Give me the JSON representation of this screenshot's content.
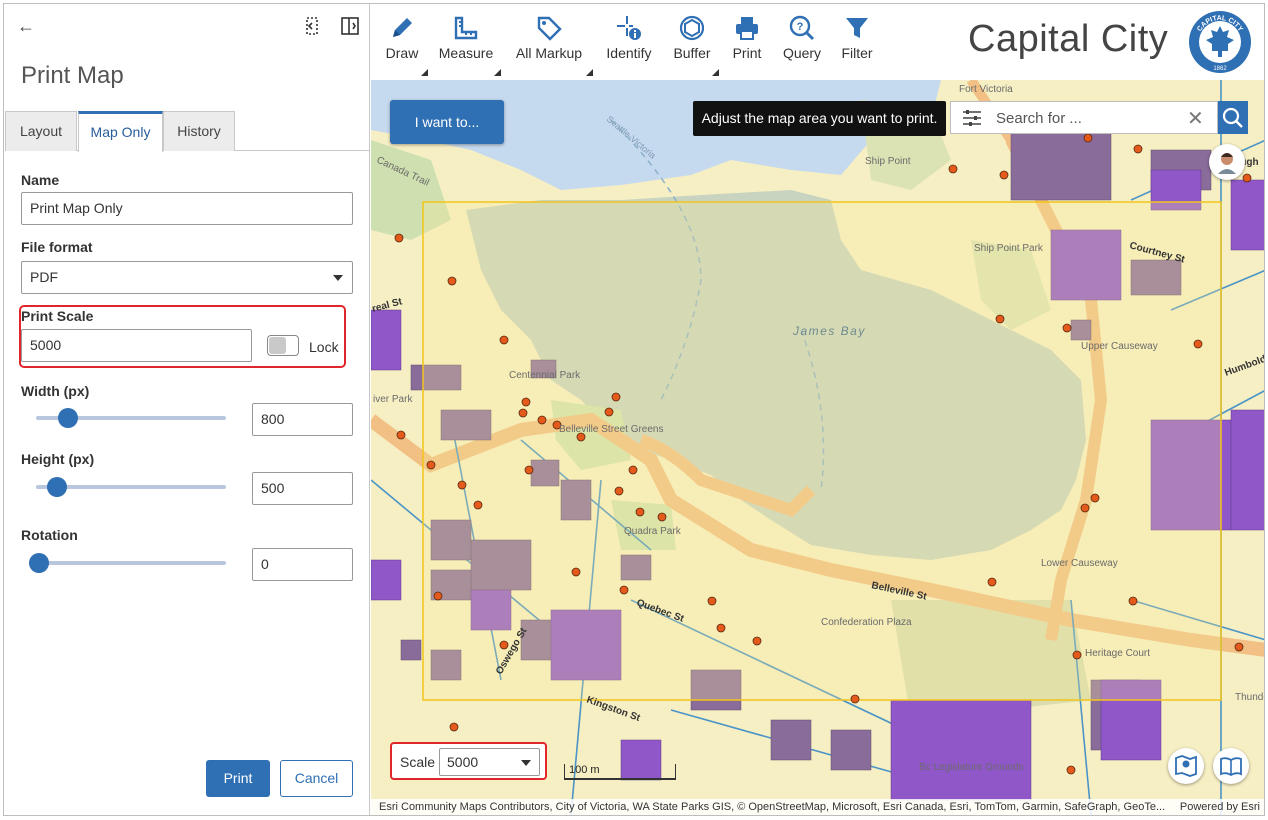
{
  "panel": {
    "title": "Print Map",
    "tabs": [
      {
        "label": "Layout"
      },
      {
        "label": "Map Only"
      },
      {
        "label": "History"
      }
    ],
    "name_label": "Name",
    "name_value": "Print Map Only",
    "file_format_label": "File format",
    "file_format_value": "PDF",
    "print_scale_label": "Print Scale",
    "print_scale_value": "5000",
    "lock_label": "Lock",
    "lock_on": false,
    "width_label": "Width (px)",
    "width_value": "800",
    "width_slider_fraction": 0.16,
    "height_label": "Height (px)",
    "height_value": "500",
    "height_slider_fraction": 0.1,
    "rotation_label": "Rotation",
    "rotation_value": "0",
    "rotation_slider_fraction": 0.0,
    "print_button": "Print",
    "cancel_button": "Cancel"
  },
  "toolbar": {
    "tools": [
      {
        "label": "Draw",
        "icon": "pencil-icon",
        "has_menu": true
      },
      {
        "label": "Measure",
        "icon": "ruler-icon",
        "has_menu": true
      },
      {
        "label": "All Markup",
        "icon": "tag-icon",
        "has_menu": true
      },
      {
        "label": "Identify",
        "icon": "identify-icon",
        "has_menu": false
      },
      {
        "label": "Buffer",
        "icon": "buffer-icon",
        "has_menu": true
      },
      {
        "label": "Print",
        "icon": "printer-icon",
        "has_menu": false
      },
      {
        "label": "Query",
        "icon": "query-icon",
        "has_menu": false
      },
      {
        "label": "Filter",
        "icon": "filter-icon",
        "has_menu": false
      }
    ],
    "app_title": "Capital City",
    "logo_text_top": "CAPITAL CITY",
    "logo_text_bottom": "1862"
  },
  "map": {
    "i_want_to": "I want to...",
    "tooltip": "Adjust the map area you want to print.",
    "search_placeholder": "Search for ...",
    "scale_label": "Scale",
    "scale_value": "5000",
    "scalebar_label": "100 m",
    "attribution": "Esri Community Maps Contributors, City of Victoria, WA State Parks GIS, © OpenStreetMap, Microsoft, Esri Canada, Esri, TomTom, Garmin, SafeGraph, GeoTe...",
    "powered_by": "Powered by Esri",
    "labels": {
      "james_bay": "James Bay",
      "centennial_park": "Centennial Park",
      "belleville_greens": "Belleville Street Greens",
      "quadra_park": "Quadra Park",
      "confederation_plaza": "Confederation Plaza",
      "belleville_st": "Belleville St",
      "quebec_st": "Quebec St",
      "oswego_st": "Oswego St",
      "kingston_st": "Kingston St",
      "ship_point": "Ship Point",
      "ship_point_park": "Ship Point Park",
      "upper_causeway": "Upper Causeway",
      "lower_causeway": "Lower Causeway",
      "heritage_court": "Heritage Court",
      "fort_victoria": "Fort Victoria",
      "courtney_st": "Courtney St",
      "humboldt": "Humboldt",
      "canada_trail": "Canada Trail",
      "seattle_victoria": "Seattle-Victoria",
      "bc_legislature": "Bc Legislature Grounds",
      "thunder": "Thunde",
      "broughton": "Brough",
      "dallas_st": "real St",
      "river_park": "iver Park"
    },
    "colors": {
      "accent": "#2f6fb4",
      "water": "#c5d9ef",
      "harbour": "#c9d4c0",
      "land": "#f7efc4",
      "road": "#f2bf84",
      "building": "#8a6c9b",
      "purple_building": "#9057c8",
      "print_frame": "#f3c41a",
      "point": "#e35a1b",
      "highlight": "#e0262b"
    }
  }
}
